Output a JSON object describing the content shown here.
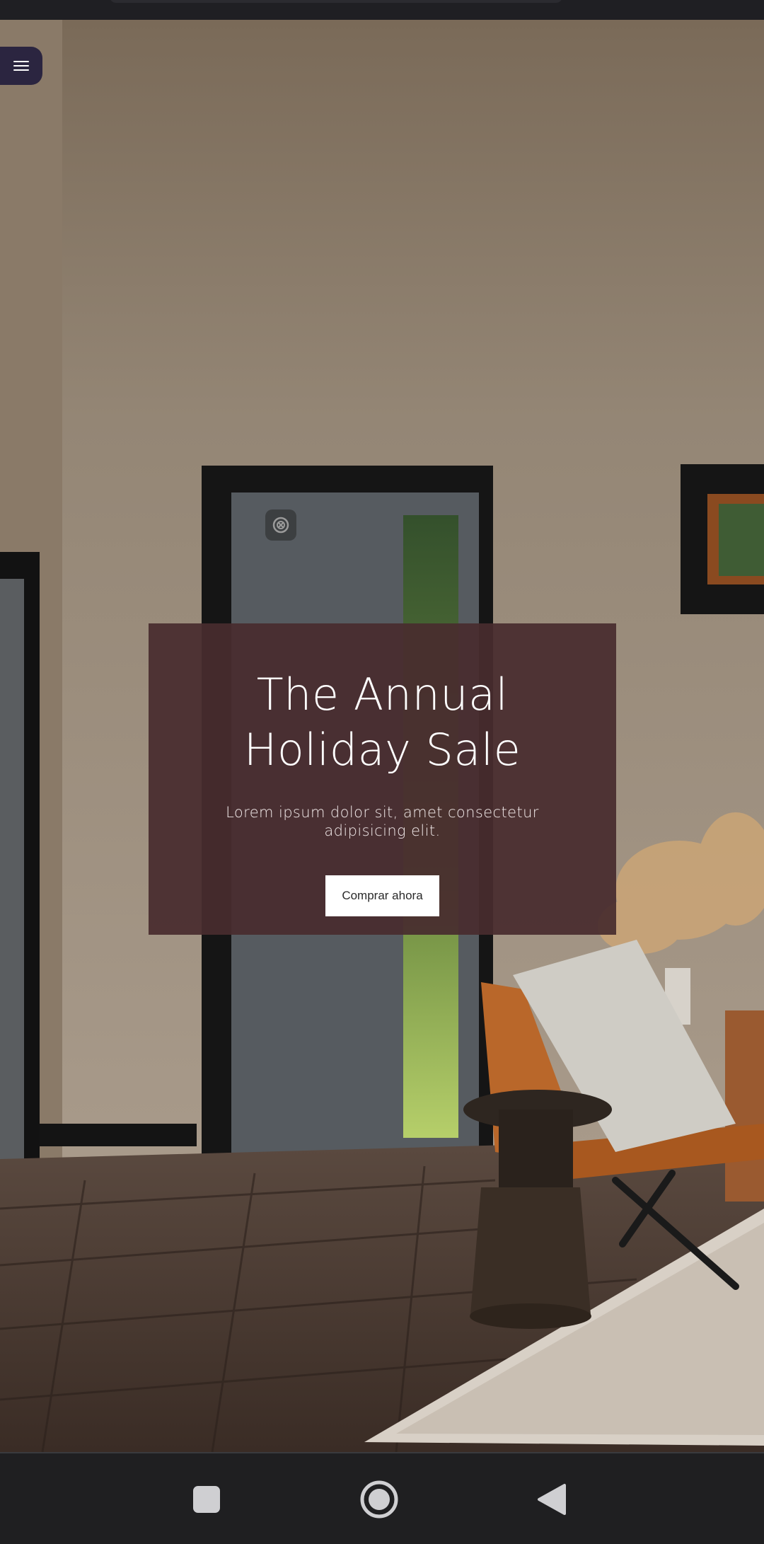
{
  "menu": {
    "icon": "menu-icon"
  },
  "hero": {
    "image": "living-room-photo",
    "title": "The Annual Holiday Sale",
    "text": "Lorem ipsum dolor sit, amet consectetur adipisicing elit.",
    "cta_label": "Comprar ahora",
    "card_color": "#482c2e"
  },
  "navigation": {
    "recents_icon": "square-icon",
    "home_icon": "circle-icon",
    "back_icon": "triangle-back-icon"
  }
}
